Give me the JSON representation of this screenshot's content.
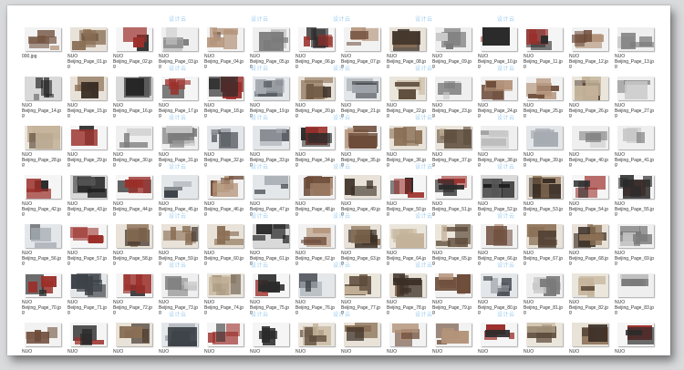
{
  "watermark": {
    "text": "设计云",
    "color": "#8fc5ec"
  },
  "file_grid": {
    "columns": 14,
    "files": [
      {
        "name": "000.jpg",
        "caption": "000.jpg"
      },
      {
        "name": "NUO Beijing_Page_01.jpg",
        "caption": "NUO\nBeijing_Page_01.jp\ng"
      },
      {
        "name": "NUO Beijing_Page_02.jpg",
        "caption": "NUO\nBeijing_Page_02.jp\ng"
      },
      {
        "name": "NUO Beijing_Page_03.jpg",
        "caption": "NUO\nBeijing_Page_03.jp\ng"
      },
      {
        "name": "NUO Beijing_Page_04.jpg",
        "caption": "NUO\nBeijing_Page_04.jp\ng"
      },
      {
        "name": "NUO Beijing_Page_05.jpg",
        "caption": "NUO\nBeijing_Page_05.jp\ng"
      },
      {
        "name": "NUO Beijing_Page_06.jpg",
        "caption": "NUO\nBeijing_Page_06.jp\ng"
      },
      {
        "name": "NUO Beijing_Page_07.jpg",
        "caption": "NUO\nBeijing_Page_07.jp\ng"
      },
      {
        "name": "NUO Beijing_Page_08.jpg",
        "caption": "NUO\nBeijing_Page_08.jp\ng"
      },
      {
        "name": "NUO Beijing_Page_09.jpg",
        "caption": "NUO\nBeijing_Page_09.jp\ng"
      },
      {
        "name": "NUO Beijing_Page_10.jpg",
        "caption": "NUO\nBeijing_Page_10.jp\ng"
      },
      {
        "name": "NUO Beijing_Page_11.jpg",
        "caption": "NUO\nBeijing_Page_11.jp\ng"
      },
      {
        "name": "NUO Beijing_Page_12.jpg",
        "caption": "NUO\nBeijing_Page_12.jp\ng"
      },
      {
        "name": "NUO Beijing_Page_13.jpg",
        "caption": "NUO\nBeijing_Page_13.jp\ng"
      },
      {
        "name": "NUO Beijing_Page_14.jpg",
        "caption": "NUO\nBeijing_Page_14.jp\ng"
      },
      {
        "name": "NUO Beijing_Page_15.jpg",
        "caption": "NUO\nBeijing_Page_15.jp\ng"
      },
      {
        "name": "NUO Beijing_Page_16.jpg",
        "caption": "NUO\nBeijing_Page_16.jp\ng"
      },
      {
        "name": "NUO Beijing_Page_17.jpg",
        "caption": "NUO\nBeijing_Page_17.jp\ng"
      },
      {
        "name": "NUO Beijing_Page_18.jpg",
        "caption": "NUO\nBeijing_Page_18.jp\ng"
      },
      {
        "name": "NUO Beijing_Page_19.jpg",
        "caption": "NUO\nBeijing_Page_19.jp\ng"
      },
      {
        "name": "NUO Beijing_Page_20.jpg",
        "caption": "NUO\nBeijing_Page_20.jp\ng"
      },
      {
        "name": "NUO Beijing_Page_21.jpg",
        "caption": "NUO\nBeijing_Page_21.jp\ng"
      },
      {
        "name": "NUO Beijing_Page_22.jpg",
        "caption": "NUO\nBeijing_Page_22.jp\ng"
      },
      {
        "name": "NUO Beijing_Page_23.jpg",
        "caption": "NUO\nBeijing_Page_23.jp\ng"
      },
      {
        "name": "NUO Beijing_Page_24.jpg",
        "caption": "NUO\nBeijing_Page_24.jp\ng"
      },
      {
        "name": "NUO Beijing_Page_25.jpg",
        "caption": "NUO\nBeijing_Page_25.jp\ng"
      },
      {
        "name": "NUO Beijing_Page_26.jpg",
        "caption": "NUO\nBeijing_Page_26.jp\ng"
      },
      {
        "name": "NUO Beijing_Page_27.jpg",
        "caption": "NUO\nBeijing_Page_27.jp\ng"
      },
      {
        "name": "NUO Beijing_Page_28.jpg",
        "caption": "NUO\nBeijing_Page_28.jp\ng"
      },
      {
        "name": "NUO Beijing_Page_29.jpg",
        "caption": "NUO\nBeijing_Page_29.jp\ng"
      },
      {
        "name": "NUO Beijing_Page_30.jpg",
        "caption": "NUO\nBeijing_Page_30.jp\ng"
      },
      {
        "name": "NUO Beijing_Page_31.jpg",
        "caption": "NUO\nBeijing_Page_31.jp\ng"
      },
      {
        "name": "NUO Beijing_Page_32.jpg",
        "caption": "NUO\nBeijing_Page_32.jp\ng"
      },
      {
        "name": "NUO Beijing_Page_33.jpg",
        "caption": "NUO\nBeijing_Page_33.jp\ng"
      },
      {
        "name": "NUO Beijing_Page_34.jpg",
        "caption": "NUO\nBeijing_Page_34.jp\ng"
      },
      {
        "name": "NUO Beijing_Page_35.jpg",
        "caption": "NUO\nBeijing_Page_35.jp\ng"
      },
      {
        "name": "NUO Beijing_Page_36.jpg",
        "caption": "NUO\nBeijing_Page_36.jp\ng"
      },
      {
        "name": "NUO Beijing_Page_37.jpg",
        "caption": "NUO\nBeijing_Page_37.jp\ng"
      },
      {
        "name": "NUO Beijing_Page_38.jpg",
        "caption": "NUO\nBeijing_Page_38.jp\ng"
      },
      {
        "name": "NUO Beijing_Page_39.jpg",
        "caption": "NUO\nBeijing_Page_39.jp\ng"
      },
      {
        "name": "NUO Beijing_Page_40.jpg",
        "caption": "NUO\nBeijing_Page_40.jp\ng"
      },
      {
        "name": "NUO Beijing_Page_41.jpg",
        "caption": "NUO\nBeijing_Page_41.jp\ng"
      },
      {
        "name": "NUO Beijing_Page_42.jpg",
        "caption": "NUO\nBeijing_Page_42.jp\ng"
      },
      {
        "name": "NUO Beijing_Page_43.jpg",
        "caption": "NUO\nBeijing_Page_43.jp\ng"
      },
      {
        "name": "NUO Beijing_Page_44.jpg",
        "caption": "NUO\nBeijing_Page_44.jp\ng"
      },
      {
        "name": "NUO Beijing_Page_45.jpg",
        "caption": "NUO\nBeijing_Page_45.jp\ng"
      },
      {
        "name": "NUO Beijing_Page_46.jpg",
        "caption": "NUO\nBeijing_Page_46.jp\ng"
      },
      {
        "name": "NUO Beijing_Page_47.jpg",
        "caption": "NUO\nBeijing_Page_47.jp\ng"
      },
      {
        "name": "NUO Beijing_Page_48.jpg",
        "caption": "NUO\nBeijing_Page_48.jp\ng"
      },
      {
        "name": "NUO Beijing_Page_49.jpg",
        "caption": "NUO\nBeijing_Page_49.jp\ng"
      },
      {
        "name": "NUO Beijing_Page_50.jpg",
        "caption": "NUO\nBeijing_Page_50.jp\ng"
      },
      {
        "name": "NUO Beijing_Page_51.jpg",
        "caption": "NUO\nBeijing_Page_51.jp\ng"
      },
      {
        "name": "NUO Beijing_Page_52.jpg",
        "caption": "NUO\nBeijing_Page_52.jp\ng"
      },
      {
        "name": "NUO Beijing_Page_53.jpg",
        "caption": "NUO\nBeijing_Page_53.jp\ng"
      },
      {
        "name": "NUO Beijing_Page_54.jpg",
        "caption": "NUO\nBeijing_Page_54.jp\ng"
      },
      {
        "name": "NUO Beijing_Page_55.jpg",
        "caption": "NUO\nBeijing_Page_55.jp\ng"
      },
      {
        "name": "NUO Beijing_Page_56.jpg",
        "caption": "NUO\nBeijing_Page_56.jp\ng"
      },
      {
        "name": "NUO Beijing_Page_57.jpg",
        "caption": "NUO\nBeijing_Page_57.jp\ng"
      },
      {
        "name": "NUO Beijing_Page_58.jpg",
        "caption": "NUO\nBeijing_Page_58.jp\ng"
      },
      {
        "name": "NUO Beijing_Page_59.jpg",
        "caption": "NUO\nBeijing_Page_59.jp\ng"
      },
      {
        "name": "NUO Beijing_Page_60.jpg",
        "caption": "NUO\nBeijing_Page_60.jp\ng"
      },
      {
        "name": "NUO Beijing_Page_61.jpg",
        "caption": "NUO\nBeijing_Page_61.jp\ng"
      },
      {
        "name": "NUO Beijing_Page_62.jpg",
        "caption": "NUO\nBeijing_Page_62.jp\ng"
      },
      {
        "name": "NUO Beijing_Page_63.jpg",
        "caption": "NUO\nBeijing_Page_63.jp\ng"
      },
      {
        "name": "NUO Beijing_Page_64.jpg",
        "caption": "NUO\nBeijing_Page_64.jp\ng"
      },
      {
        "name": "NUO Beijing_Page_65.jpg",
        "caption": "NUO\nBeijing_Page_65.jp\ng"
      },
      {
        "name": "NUO Beijing_Page_66.jpg",
        "caption": "NUO\nBeijing_Page_66.jp\ng"
      },
      {
        "name": "NUO Beijing_Page_67.jpg",
        "caption": "NUO\nBeijing_Page_67.jp\ng"
      },
      {
        "name": "NUO Beijing_Page_68.jpg",
        "caption": "NUO\nBeijing_Page_68.jp\ng"
      },
      {
        "name": "NUO Beijing_Page_69.jpg",
        "caption": "NUO\nBeijing_Page_69.jp\ng"
      },
      {
        "name": "NUO Beijing_Page_70.jpg",
        "caption": "NUO\nBeijing_Page_70.jp\ng"
      },
      {
        "name": "NUO Beijing_Page_71.jpg",
        "caption": "NUO\nBeijing_Page_71.jp\ng"
      },
      {
        "name": "NUO Beijing_Page_72.jpg",
        "caption": "NUO\nBeijing_Page_72.jp\ng"
      },
      {
        "name": "NUO Beijing_Page_73.jpg",
        "caption": "NUO\nBeijing_Page_73.jp\ng"
      },
      {
        "name": "NUO Beijing_Page_74.jpg",
        "caption": "NUO\nBeijing_Page_74.jp\ng"
      },
      {
        "name": "NUO Beijing_Page_75.jpg",
        "caption": "NUO\nBeijing_Page_75.jp\ng"
      },
      {
        "name": "NUO Beijing_Page_76.jpg",
        "caption": "NUO\nBeijing_Page_76.jp\ng"
      },
      {
        "name": "NUO Beijing_Page_77.jpg",
        "caption": "NUO\nBeijing_Page_77.jp\ng"
      },
      {
        "name": "NUO Beijing_Page_78.jpg",
        "caption": "NUO\nBeijing_Page_78.jp\ng"
      },
      {
        "name": "NUO Beijing_Page_79.jpg",
        "caption": "NUO\nBeijing_Page_79.jp\ng"
      },
      {
        "name": "NUO Beijing_Page_80.jpg",
        "caption": "NUO\nBeijing_Page_80.jp\ng"
      },
      {
        "name": "NUO Beijing_Page_81.jpg",
        "caption": "NUO\nBeijing_Page_81.jp\ng"
      },
      {
        "name": "NUO Beijing_Page_82.jpg",
        "caption": "NUO\nBeijing_Page_82.jp\ng"
      },
      {
        "name": "NUO Beijing_Page_83.jpg",
        "caption": "NUO\nBeijing_Page_83.jp\ng"
      },
      {
        "name": "NUO",
        "caption": "NUO"
      },
      {
        "name": "NUO",
        "caption": "NUO"
      },
      {
        "name": "NUO",
        "caption": "NUO"
      },
      {
        "name": "NUO",
        "caption": "NUO"
      },
      {
        "name": "NUO",
        "caption": "NUO"
      },
      {
        "name": "NUO",
        "caption": "NUO"
      },
      {
        "name": "NUO",
        "caption": "NUO"
      },
      {
        "name": "NUO",
        "caption": "NUO"
      },
      {
        "name": "NUO",
        "caption": "NUO"
      },
      {
        "name": "NUO",
        "caption": "NUO"
      },
      {
        "name": "NUO",
        "caption": "NUO"
      },
      {
        "name": "NUO",
        "caption": "NUO"
      },
      {
        "name": "NUO",
        "caption": "NUO"
      },
      {
        "name": "NUO",
        "caption": "NUO"
      }
    ]
  }
}
